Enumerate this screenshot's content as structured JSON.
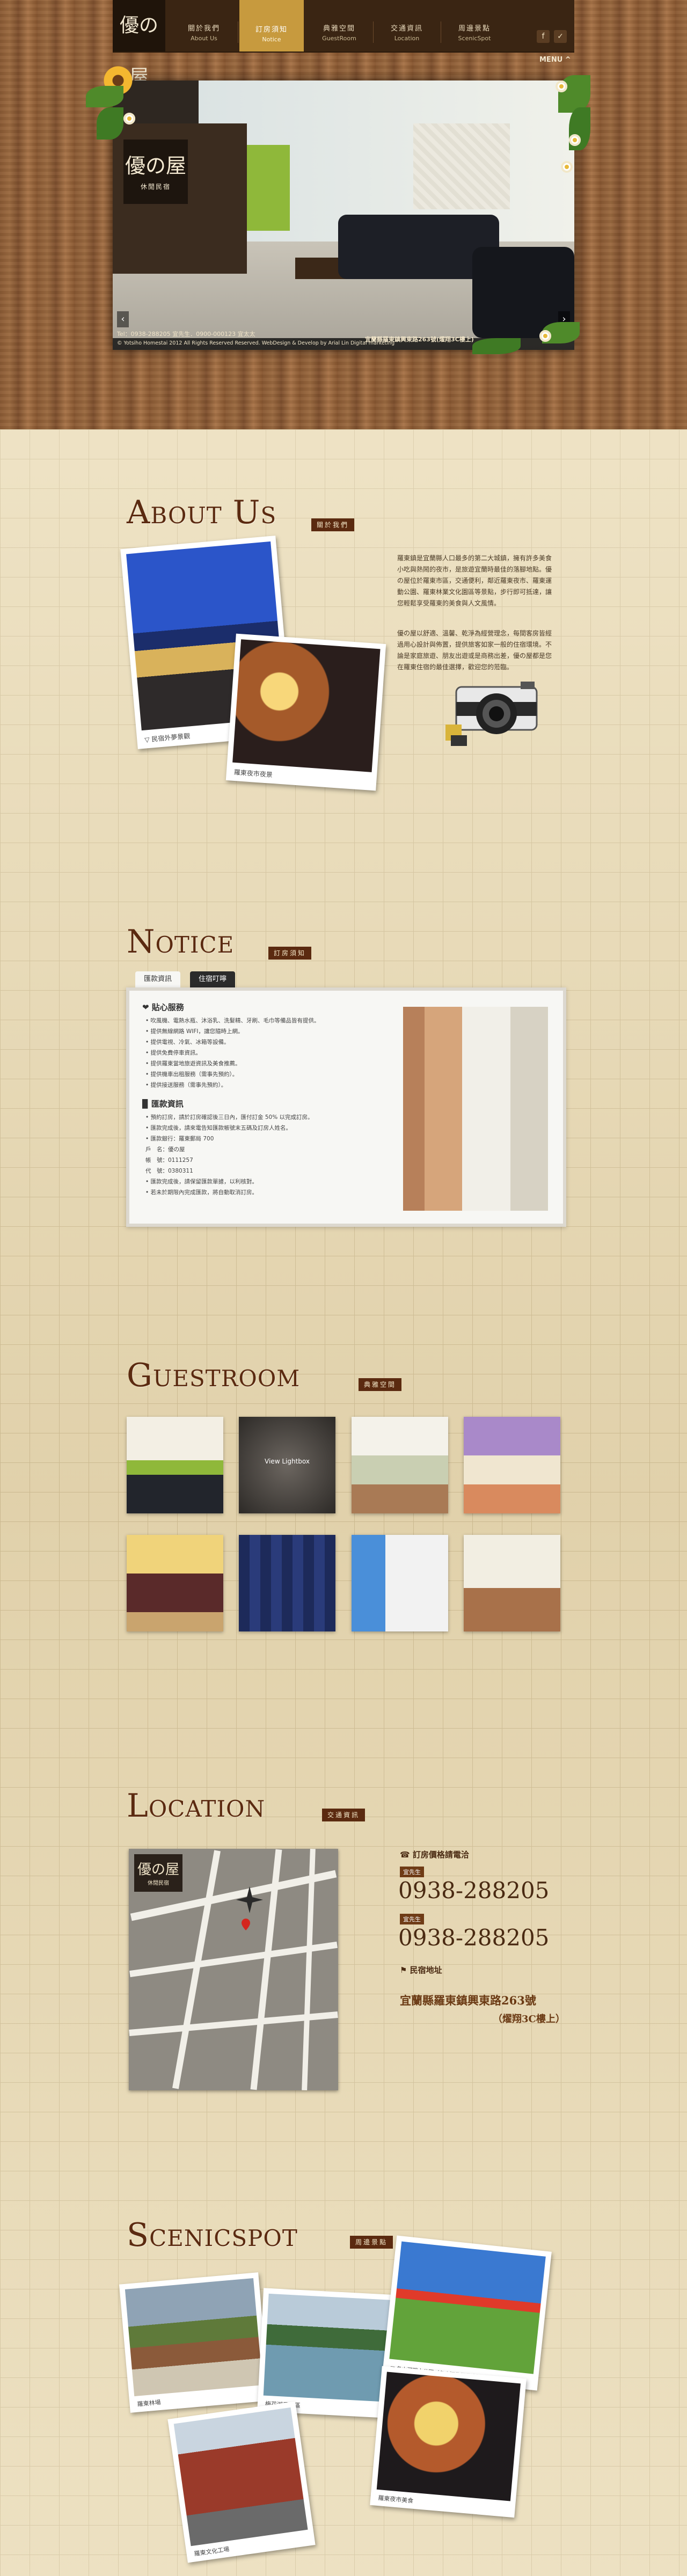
{
  "nav": {
    "logo": "優の屋",
    "items": [
      {
        "zh": "關於我們",
        "en": "About Us"
      },
      {
        "zh": "訂房須知",
        "en": "Notice"
      },
      {
        "zh": "典雅空間",
        "en": "GuestRoom"
      },
      {
        "zh": "交通資訊",
        "en": "Location"
      },
      {
        "zh": "周邊景點",
        "en": "ScenicSpot"
      }
    ],
    "social": [
      "f",
      "✓"
    ],
    "menu_label": "MENU ^"
  },
  "hero": {
    "logo_big": "優の屋",
    "logo_small": "休閒民宿",
    "info_left_1": "Tel：0938-288205 宜先生．0900-000123 宜太太",
    "info_left_2": "© Yotsiho Homestai 2012 All Rights Reserved Reserved. WebDesign & Develop by Arial Lin Digital marketing",
    "info_right": "宜蘭縣羅東鎮興東路263號(燿翔3C樓上)",
    "arrow_prev": "‹",
    "arrow_next": "›"
  },
  "about": {
    "title": "About Us",
    "tag": "關於我們",
    "photo1_caption": "▽ 民宿外夢景觀",
    "photo2_caption": "羅東夜市夜景",
    "para1": "羅東鎮是宜蘭縣人口最多的第二大城鎮，擁有許多美食小吃與熱鬧的夜市，是旅遊宜蘭時最佳的落腳地點。優の屋位於羅東市區，交通便利，鄰近羅東夜市、羅東運動公園、羅東林業文化園區等景點，步行即可抵達，讓您輕鬆享受羅東的美食與人文風情。",
    "para2": "優の屋以舒適、溫馨、乾淨為經營理念，每間客房皆經過用心設計與佈置，提供旅客如家一般的住宿環境。不論是家庭旅遊、朋友出遊或是商務出差，優の屋都是您在羅東住宿的最佳選擇，歡迎您的蒞臨。"
  },
  "notice": {
    "title": "Notice",
    "tag": "訂房須知",
    "tabs": [
      "匯款資訊",
      "住宿叮嚀"
    ],
    "sec1_head": "❤ 貼心服務",
    "sec1_lines": [
      "• 吹風機、電熱水瓶、沐浴乳、洗髮精、牙刷、毛巾等備品皆有提供。",
      "• 提供無線網路 WIFI，讓您隨時上網。",
      "• 提供電視、冷氣、冰箱等設備。",
      "• 提供免費停車資訊。",
      "• 提供羅東當地旅遊資訊及美食推薦。",
      "• 提供機車出租服務（需事先預約）。",
      "• 提供接送服務（需事先預約）。"
    ],
    "sec2_head": "▉ 匯款資訊",
    "sec2_lines": [
      "• 預約訂房，請於訂房確認後三日內，匯付訂金 50% 以完成訂房。",
      "• 匯款完成後，請來電告知匯款帳號末五碼及訂房人姓名。",
      "• 匯款銀行：羅東郵局 700",
      "  戶　名：優の屋",
      "  帳　號：0111257",
      "  代　號：0380311",
      "• 匯款完成後，請保留匯款單據，以利核對。",
      "• 若未於期限內完成匯款，將自動取消訂房。"
    ]
  },
  "guestroom": {
    "title": "Guestroom",
    "tag": "典雅空間",
    "lightbox": "View Lightbox"
  },
  "location": {
    "title": "Location",
    "tag": "交通資訊",
    "map_logo": "優の屋",
    "map_logo_sub": "休閒民宿",
    "contact_head": "☎ 訂房價格請電洽",
    "contacts": [
      {
        "label": "宜先生",
        "phone": "0938-288205"
      },
      {
        "label": "宜先生",
        "phone": "0938-288205"
      }
    ],
    "address_head": "⚑ 民宿地址",
    "address_line1": "宜蘭縣羅東鎮興東路263號",
    "address_line2": "（燿翔3C樓上）"
  },
  "scenicspot": {
    "title": "Scenicspot",
    "tag": "周邊景點",
    "spots": [
      "羅東林場",
      "梅花湖風景區",
      "▽ 冬山河親水公園（冬山河生態綠舟）",
      "羅東文化工場",
      "羅東夜市美食"
    ]
  },
  "colors": {
    "brand": "#5b2a10",
    "nav_bg": "#3a2513",
    "nav_active": "#c79a3e"
  }
}
